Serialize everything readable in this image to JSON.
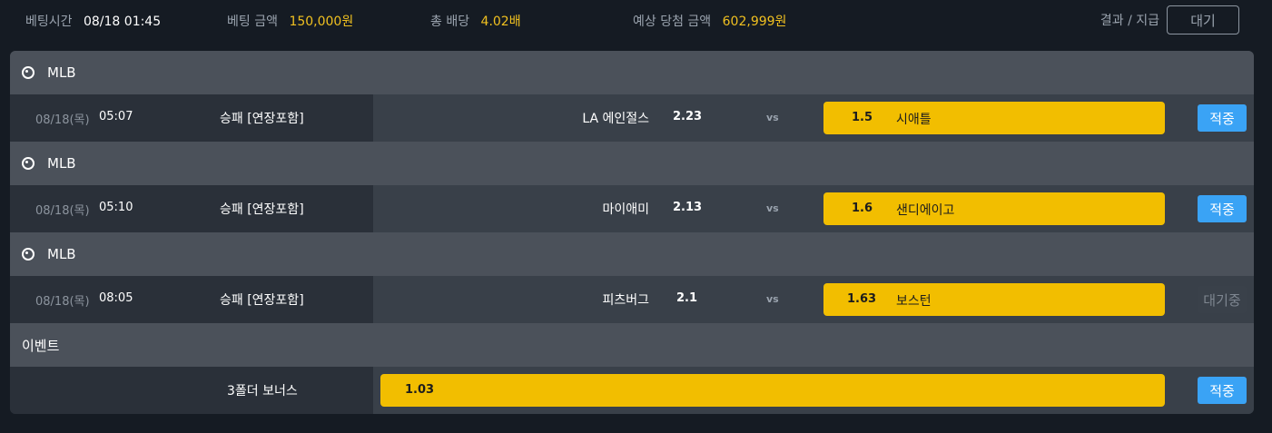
{
  "summary": {
    "bet_time_label": "베팅시간",
    "bet_time": "08/18 01:45",
    "bet_amount_label": "베팅 금액",
    "bet_amount": "150,000원",
    "total_odds_label": "총 배당",
    "total_odds": "4.02배",
    "expected_win_label": "예상 당첨 금액",
    "expected_win": "602,999원",
    "status_label": "결과 / 지급",
    "status_button": "대기"
  },
  "bets": [
    {
      "league": "MLB",
      "date": "08/18(목)",
      "time": "05:07",
      "market": "승패 [연장포함]",
      "home_team": "LA 에인절스",
      "home_odds": "2.23",
      "vs": "vs",
      "away_odds": "1.5",
      "away_team": "시애틀",
      "result": "적중"
    },
    {
      "league": "MLB",
      "date": "08/18(목)",
      "time": "05:10",
      "market": "승패 [연장포함]",
      "home_team": "마이애미",
      "home_odds": "2.13",
      "vs": "vs",
      "away_odds": "1.6",
      "away_team": "샌디에이고",
      "result": "적중"
    },
    {
      "league": "MLB",
      "date": "08/18(목)",
      "time": "08:05",
      "market": "승패 [연장포함]",
      "home_team": "피츠버그",
      "home_odds": "2.1",
      "vs": "vs",
      "away_odds": "1.63",
      "away_team": "보스턴",
      "result": "대기중"
    }
  ],
  "event": {
    "header": "이벤트",
    "label": "3폴더 보너스",
    "odds": "1.03",
    "result": "적중"
  },
  "colors": {
    "accent_yellow": "#f2be00",
    "hit_blue": "#3aa3f5",
    "summary_value": "#f0c020"
  }
}
